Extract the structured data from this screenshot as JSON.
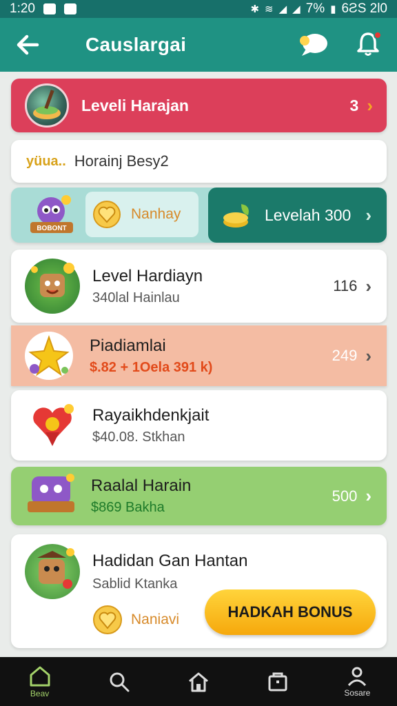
{
  "status_bar": {
    "time": "1:20",
    "battery": "7%",
    "right_text": "6ƧS 2l0"
  },
  "app_bar": {
    "title": "Causlargai"
  },
  "header_card": {
    "label": "Leveli Harajan",
    "value": "3"
  },
  "search": {
    "prefix": "yüua..",
    "text": "Horainj Besy2"
  },
  "combo": {
    "badge_text": "BOBONT",
    "left_label": "Nanhay",
    "right_label": "Levelah 300"
  },
  "list": [
    {
      "title": "Level Hardiayn",
      "subtitle": "340lal Hainlau",
      "value": "116"
    },
    {
      "title": "Piadiamlai",
      "subtitle": "$.82 + 1Oela 391 k)",
      "value": "249"
    },
    {
      "title": "Rayaikhdenkjait",
      "subtitle": "$40.08. Stkhan",
      "value": ""
    },
    {
      "title": "Raalal Harain",
      "subtitle": "$869 Bakha",
      "value": "500"
    },
    {
      "title": "Hadidan Gan Hantan",
      "subtitle": "Sablid Ktanka",
      "value": ""
    }
  ],
  "bottom_card": {
    "coin_label": "Naniavi",
    "button": "HADKAH BONUS"
  },
  "bottom_nav": {
    "home_label": "Beav",
    "profile_label": "Sosare"
  },
  "colors": {
    "primary": "#1f9283",
    "red": "#dc3f5a",
    "orange_row": "#f4bca3",
    "green_row": "#95cf72",
    "button": "#ffc21f"
  }
}
